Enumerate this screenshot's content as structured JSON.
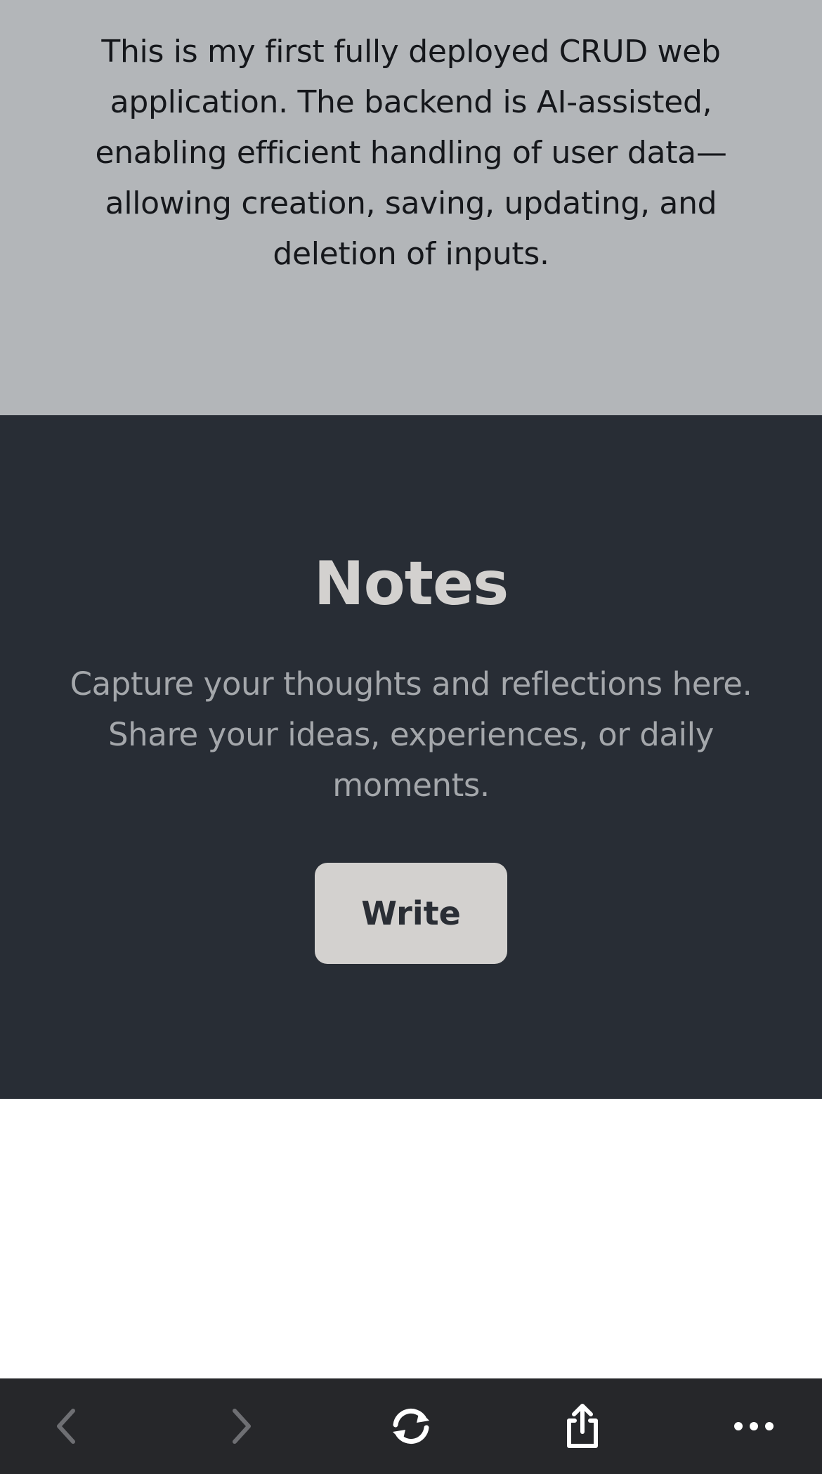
{
  "intro": {
    "text": "This is my first fully deployed CRUD web application. The backend is AI-assisted, enabling efficient handling of user data—allowing creation, saving, updating, and deletion of inputs."
  },
  "notes": {
    "title": "Notes",
    "description": "Capture your thoughts and reflections here. Share your ideas, experiences, or daily moments.",
    "write_label": "Write"
  },
  "toolbar": {
    "icons": [
      "back-arrow-icon",
      "forward-arrow-icon",
      "reload-icon",
      "share-icon",
      "more-icon"
    ]
  },
  "colors": {
    "intro_bg": "#b3b6b9",
    "notes_bg": "#282d35",
    "button_bg": "#d3d1cf",
    "toolbar_bg": "#26272a"
  }
}
